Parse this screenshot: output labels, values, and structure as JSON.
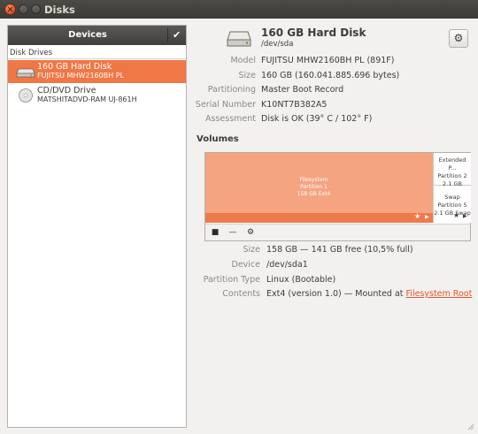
{
  "window": {
    "title": "Disks"
  },
  "sidebar": {
    "header": "Devices",
    "section_label": "Disk Drives",
    "drives": [
      {
        "name": "160 GB Hard Disk",
        "model": "FUJITSU MHW2160BH PL",
        "icon": "hard-disk-icon",
        "selected": true
      },
      {
        "name": "CD/DVD Drive",
        "model": "MATSHITADVD-RAM UJ-861H",
        "icon": "optical-disc-icon",
        "selected": false
      }
    ]
  },
  "disk": {
    "title": "160 GB Hard Disk",
    "path": "/dev/sda",
    "properties": {
      "model_label": "Model",
      "model": "FUJITSU MHW2160BH PL (891F)",
      "size_label": "Size",
      "size": "160 GB (160.041.885.696 bytes)",
      "partitioning_label": "Partitioning",
      "partitioning": "Master Boot Record",
      "serial_label": "Serial Number",
      "serial": "K10NT7B382A5",
      "assessment_label": "Assessment",
      "assessment": "Disk is OK (39° C / 102° F)"
    }
  },
  "volumes": {
    "heading": "Volumes",
    "partitions": {
      "main": {
        "line1": "Filesystem",
        "line2": "Partition 1",
        "line3": "158 GB Ext4"
      },
      "extended": {
        "line1": "Extended P...",
        "line2": "Partition 2",
        "line3": "2.1 GB"
      },
      "swap": {
        "line1": "Swap",
        "line2": "Partition 5",
        "line3": "2.1 GB Swap"
      }
    },
    "selected": {
      "size_label": "Size",
      "size": "158 GB — 141 GB free (10,5% full)",
      "device_label": "Device",
      "device": "/dev/sda1",
      "partition_type_label": "Partition Type",
      "partition_type": "Linux (Bootable)",
      "contents_label": "Contents",
      "contents_prefix": "Ext4 (version 1.0) — Mounted at ",
      "contents_link": "Filesystem Root"
    }
  },
  "colors": {
    "accent": "#f07746",
    "partition_fill": "#f5a481",
    "link": "#e2562a"
  }
}
